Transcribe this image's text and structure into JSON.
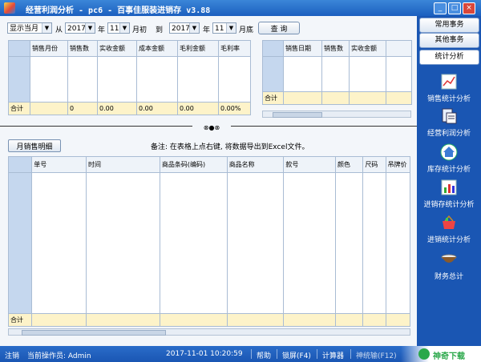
{
  "window": {
    "title": "经营利润分析 - pc6 - 百事佳服装进销存 v3.88",
    "min_label": "_",
    "max_label": "□",
    "close_label": "×"
  },
  "filter": {
    "period_mode": "显示当月",
    "from_label": "从",
    "from_year": "2017",
    "year_label_1": "年",
    "from_month": "11",
    "month_start_label": "月初",
    "to_label": "到",
    "to_year": "2017",
    "year_label_2": "年",
    "to_month": "11",
    "month_end_label": "月底",
    "query_label": "查 询"
  },
  "monthly_table": {
    "headers": [
      "销售月份",
      "销售数",
      "实收金额",
      "成本金额",
      "毛利金额",
      "毛利率"
    ],
    "total_label": "合计",
    "totals": [
      "",
      "0",
      "0.00",
      "0.00",
      "0.00",
      "0.00%"
    ]
  },
  "daily_table": {
    "headers": [
      "销售日期",
      "销售数",
      "实收金额"
    ],
    "total_label": "合计"
  },
  "splitter": {
    "glyphs": "⊗●⊗"
  },
  "detail": {
    "tab_label": "月销售明细",
    "note": "备注: 在表格上点右键, 将数据导出到Excel文件。",
    "headers": [
      "单号",
      "时间",
      "商品条码(编码)",
      "商品名称",
      "款号",
      "颜色",
      "尺码",
      "吊牌价"
    ],
    "total_label": "合计"
  },
  "sidebar": {
    "tabs": [
      "常用事务",
      "其他事务",
      "统计分析"
    ],
    "items": [
      {
        "label": "销售统计分析",
        "icon": "sales-chart-icon"
      },
      {
        "label": "经营利润分析",
        "icon": "profit-report-icon"
      },
      {
        "label": "库存统计分析",
        "icon": "house-icon"
      },
      {
        "label": "进销存统计分析",
        "icon": "bar-chart-icon"
      },
      {
        "label": "进销统计分析",
        "icon": "shopping-basket-icon"
      },
      {
        "label": "财务总计",
        "icon": "bowl-icon"
      }
    ]
  },
  "status": {
    "cancel": "注销",
    "operator": "当前操作员: Admin",
    "datetime": "2017-11-01  10:20:59",
    "help": "帮助",
    "lock": "锁屏(F4)",
    "calc": "计算器",
    "input": "神统输(F12)",
    "brand": "神奇下载"
  },
  "colors": {
    "title_bar": "#1b5fbf",
    "sidebar": "#1a56b3",
    "total_row": "#fdf3c9",
    "row_header": "#c5d7ee"
  }
}
